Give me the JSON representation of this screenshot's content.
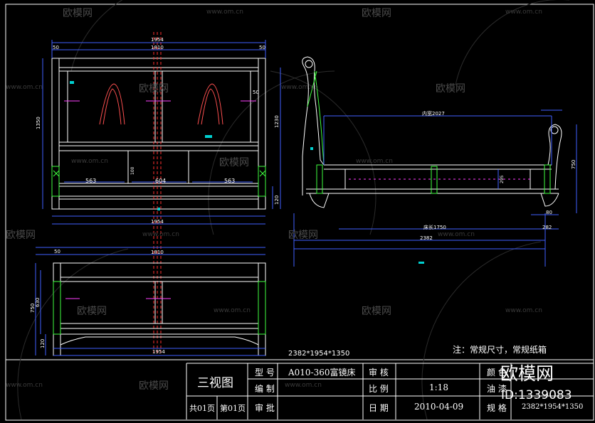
{
  "drawing": {
    "overall_dims": "2382*1954*1350",
    "note": "注：常规尺寸，常规纸箱",
    "dims_front": {
      "top_total": "1954",
      "top_inner": "1810",
      "left_post": "50",
      "right_post": "50",
      "height_total": "1350",
      "right_height": "1230",
      "bottom_gap": "120",
      "panel_left": "563",
      "panel_mid": "604",
      "panel_right": "563",
      "mid_small": "100",
      "bottom_total": "1954",
      "side_small": "50"
    },
    "dims_side": {
      "inner": "内宽2027",
      "bed_len": "床长1750",
      "total_len": "2382",
      "right_small": "80",
      "right_ext": "282",
      "right_height": "750",
      "mid_height": "295"
    },
    "dims_foot": {
      "top_total": "50",
      "top_inner": "1810",
      "height_a": "750",
      "height_b": "630",
      "height_c": "120",
      "bottom_total": "1954"
    }
  },
  "title_block": {
    "view_name": "三视图",
    "pages": "共01页",
    "page_no": "第01页",
    "model_label": "型 号",
    "model_value": "A010-360富镜床",
    "drafter_label": "编 制",
    "approve_label": "审 批",
    "review_label": "审 核",
    "scale_label": "比 例",
    "scale_value": "1:18",
    "date_label": "日 期",
    "date_value": "2010-04-09",
    "color_label": "颜 色",
    "paint_label": "油 漆",
    "spec_label": "规 格",
    "spec_value": "2382*1954*1350"
  },
  "brand": {
    "name": "欧模网",
    "id": "ID:1339083"
  },
  "watermark": {
    "logo_text": "欧模网",
    "url": "www.om.cn"
  }
}
